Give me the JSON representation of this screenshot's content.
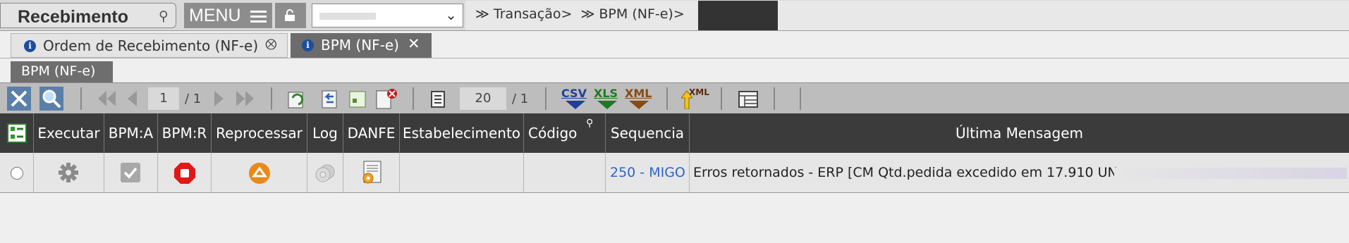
{
  "header": {
    "title": "Recebimento",
    "menu_label": "MENU",
    "breadcrumbs": [
      "≫ Transação>",
      "≫ BPM (NF-e)>"
    ]
  },
  "tabs": [
    {
      "label": "Ordem de Recebimento (NF-e)",
      "close": "⮾",
      "active": false
    },
    {
      "label": "BPM (NF-e)",
      "close": "✕",
      "active": true
    }
  ],
  "subtab": {
    "label": "BPM (NF-e)"
  },
  "toolbar": {
    "page_current": "1",
    "page_total": "/ 1",
    "rows_per_page": "20",
    "rows_total": "/ 1",
    "export_csv": "CSV",
    "export_xls": "XLS",
    "export_xml": "XML",
    "import_xml": "XML"
  },
  "table": {
    "columns": [
      "Executar",
      "BPM:A",
      "BPM:R",
      "Reprocessar",
      "Log",
      "DANFE",
      "Estabelecimento",
      "Código",
      "Sequencia",
      "Última Mensagem"
    ],
    "rows": [
      {
        "sequencia": "250 - MIGO",
        "ultima_mensagem": "Erros retornados - ERP [CM Qtd.pedida excedido em 17.910 UN"
      }
    ]
  },
  "colors": {
    "header_bg": "#3b3b3b",
    "link": "#2f65c4",
    "active_tab": "#6c6c6c"
  }
}
